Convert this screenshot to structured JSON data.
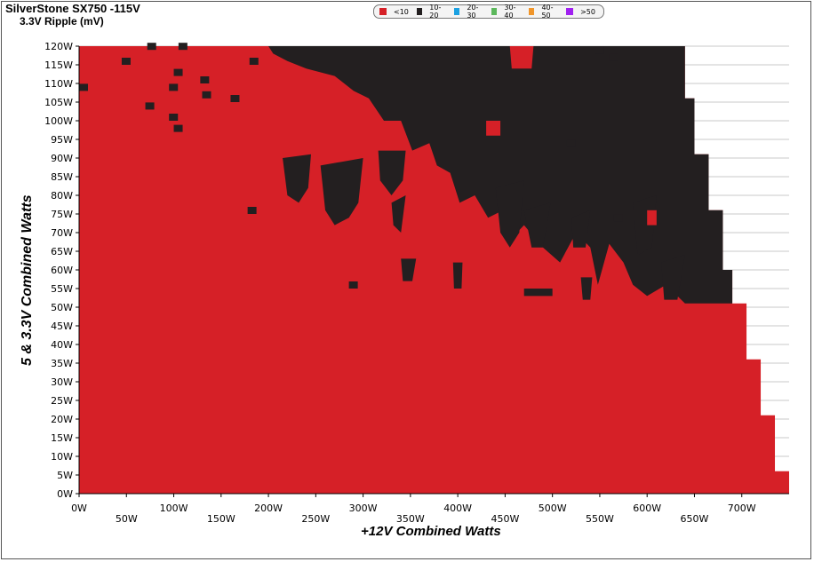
{
  "chart_title": "SilverStone SX750 -115V",
  "chart_subtitle": "3.3V Ripple (mV)",
  "colors": {
    "lt10": "#d62027",
    "c10_20": "#231f20",
    "c20_30": "#1ba1e2",
    "c30_40": "#5cb85c",
    "c40_50": "#f0962b",
    "gt50": "#a020f0",
    "grid": "#c8c8c8"
  },
  "legend": [
    {
      "label": "<10",
      "color": "#d62027"
    },
    {
      "label": "10-20",
      "color": "#231f20"
    },
    {
      "label": "20-30",
      "color": "#1ba1e2"
    },
    {
      "label": "30-40",
      "color": "#5cb85c"
    },
    {
      "label": "40-50",
      "color": "#f0962b"
    },
    {
      "label": ">50",
      "color": "#a020f0"
    }
  ],
  "chart_data": {
    "type": "heatmap",
    "title": "SilverStone SX750 -115V",
    "subtitle": "3.3V Ripple (mV)",
    "xlabel": "+12V Combined Watts",
    "ylabel": "5 & 3.3V Combined Watts",
    "xlim": [
      0,
      750
    ],
    "ylim": [
      0,
      120
    ],
    "x_ticks": [
      "0W",
      "50W",
      "100W",
      "150W",
      "200W",
      "250W",
      "300W",
      "350W",
      "400W",
      "450W",
      "500W",
      "550W",
      "600W",
      "650W",
      "700W"
    ],
    "y_ticks": [
      "0W",
      "5W",
      "10W",
      "15W",
      "20W",
      "25W",
      "30W",
      "35W",
      "40W",
      "45W",
      "50W",
      "55W",
      "60W",
      "65W",
      "70W",
      "75W",
      "80W",
      "85W",
      "90W",
      "95W",
      "100W",
      "105W",
      "110W",
      "115W",
      "120W"
    ],
    "max_x_for_y": [
      {
        "y_from": 0,
        "y_to": 6,
        "x_max": 750
      },
      {
        "y_from": 6,
        "y_to": 21,
        "x_max": 735
      },
      {
        "y_from": 21,
        "y_to": 36,
        "x_max": 720
      },
      {
        "y_from": 36,
        "y_to": 51,
        "x_max": 705
      },
      {
        "y_from": 51,
        "y_to": 60,
        "x_max": 690
      },
      {
        "y_from": 60,
        "y_to": 76,
        "x_max": 680
      },
      {
        "y_from": 76,
        "y_to": 91,
        "x_max": 665
      },
      {
        "y_from": 91,
        "y_to": 106,
        "x_max": 650
      },
      {
        "y_from": 106,
        "y_to": 120,
        "x_max": 640
      }
    ],
    "ranges": [
      {
        "label": "<10",
        "region": "most of the load range (low +12V load and low minor-rail load)"
      },
      {
        "label": "10-20",
        "region": "high minor-rail load combined with moderate-to-high +12V load"
      }
    ]
  }
}
